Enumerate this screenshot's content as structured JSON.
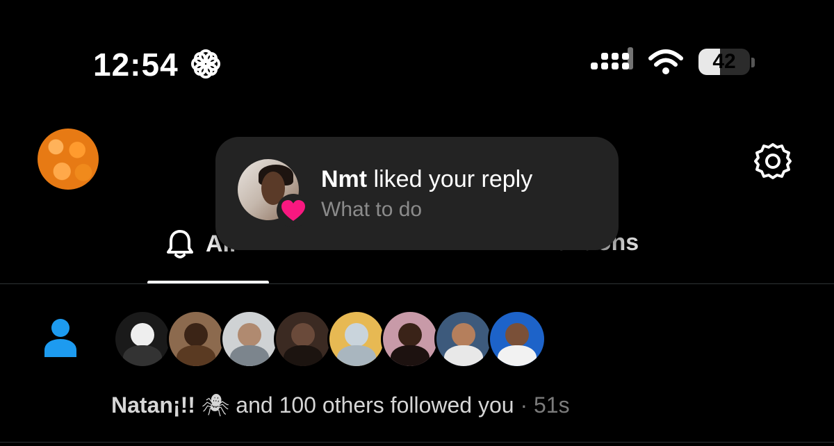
{
  "status_bar": {
    "time": "12:54",
    "battery_level": "42",
    "battery_fraction": 0.42
  },
  "tabs": {
    "all_label": "All",
    "mentions_label": "Mentions"
  },
  "toast": {
    "user": "Nmt",
    "action": " liked your reply",
    "preview": "What to do",
    "heart_color": "#f91880"
  },
  "follow_notification": {
    "name": "Natan¡!!",
    "emoji": "🕷",
    "text": " and 100 others followed you",
    "separator": " · ",
    "time": "51s",
    "icon_color": "#1d9bf0",
    "avatar_count": 8
  },
  "colors": {
    "accent": "#1d9bf0",
    "like": "#f91880",
    "background": "#000000"
  }
}
